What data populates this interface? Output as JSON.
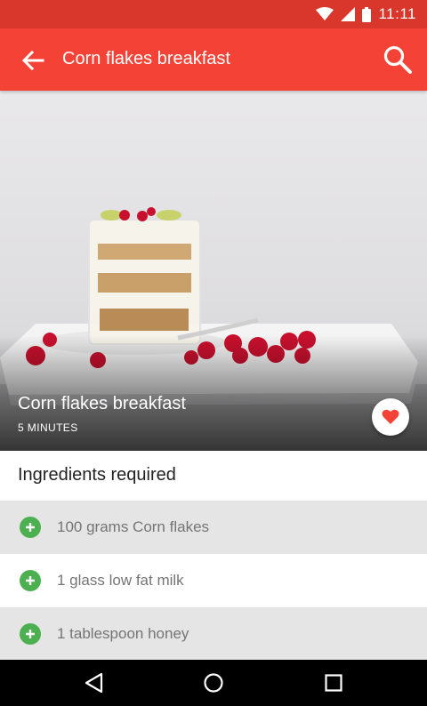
{
  "status_bar": {
    "time": "11:11",
    "icons": [
      "wifi-icon",
      "signal-icon",
      "battery-icon"
    ],
    "background": "#D9372B"
  },
  "app_bar": {
    "title": "Corn flakes breakfast",
    "back_icon": "arrow-back-icon",
    "search_icon": "search-icon",
    "background": "#F44336"
  },
  "hero": {
    "title": "Corn flakes breakfast",
    "subtitle": "5 MINUTES",
    "favorite_icon": "heart-icon",
    "favorite_color": "#F44336"
  },
  "ingredients": {
    "heading": "Ingredients required",
    "add_icon": "plus-circle-icon",
    "add_color": "#4CAF50",
    "items": [
      "100 grams Corn flakes",
      "1 glass low fat milk",
      "1 tablespoon honey"
    ]
  },
  "nav_bar": {
    "buttons": [
      "back-triangle-icon",
      "home-circle-icon",
      "recents-square-icon"
    ]
  }
}
